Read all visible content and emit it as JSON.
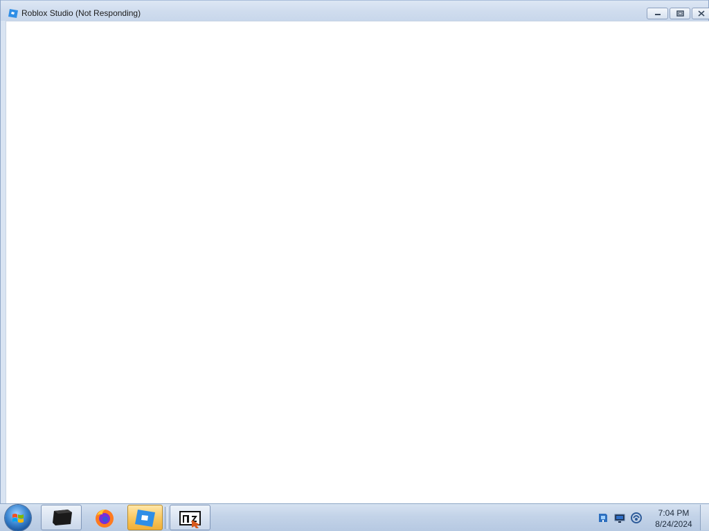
{
  "window": {
    "title": "Roblox Studio (Not Responding)",
    "icon": "roblox-studio-icon",
    "controls": {
      "minimize": "minimize-icon",
      "maximize": "restore-icon",
      "close": "close-icon"
    }
  },
  "taskbar": {
    "start_button": "windows-start-orb",
    "items": [
      {
        "icon": "terminal-window-icon"
      },
      {
        "icon": "firefox-icon"
      },
      {
        "icon": "roblox-studio-icon",
        "active": true
      },
      {
        "icon": "app-window-icon"
      }
    ],
    "tray": {
      "icons": [
        "action-center-icon",
        "network-icon",
        "volume-icon"
      ]
    },
    "clock": {
      "time": "7:04 PM",
      "date": "8/24/2024"
    }
  },
  "colors": {
    "title_bar": "#cfdcee",
    "taskbar": "#c3d3e8",
    "active_task": "#f8c65c",
    "client_area": "#ffffff"
  }
}
